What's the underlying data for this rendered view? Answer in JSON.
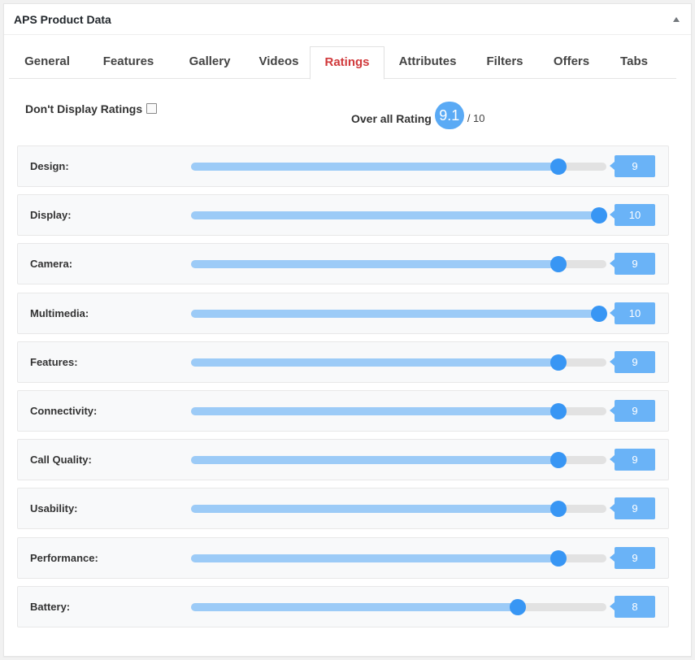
{
  "panel": {
    "title": "APS Product Data",
    "toggle_icon": "triangle-up-icon"
  },
  "tabs": [
    {
      "label": "General"
    },
    {
      "label": "Features"
    },
    {
      "label": "Gallery"
    },
    {
      "label": "Videos"
    },
    {
      "label": "Ratings",
      "active": true
    },
    {
      "label": "Attributes"
    },
    {
      "label": "Filters"
    },
    {
      "label": "Offers"
    },
    {
      "label": "Tabs"
    }
  ],
  "ratings": {
    "dont_display_label": "Don't Display Ratings",
    "dont_display_checked": false,
    "overall_label": "Over all Rating",
    "overall_value": "9.1",
    "overall_max": "/ 10",
    "max": 10,
    "items": [
      {
        "label": "Design:",
        "value": 9
      },
      {
        "label": "Display:",
        "value": 10
      },
      {
        "label": "Camera:",
        "value": 9
      },
      {
        "label": "Multimedia:",
        "value": 10
      },
      {
        "label": "Features:",
        "value": 9
      },
      {
        "label": "Connectivity:",
        "value": 9
      },
      {
        "label": "Call Quality:",
        "value": 9
      },
      {
        "label": "Usability:",
        "value": 9
      },
      {
        "label": "Performance:",
        "value": 9
      },
      {
        "label": "Battery:",
        "value": 8
      }
    ]
  },
  "colors": {
    "accent": "#3896f4",
    "active_tab": "#d0393b",
    "value_box": "#6ab3f7",
    "track_fill": "#9ccbf7"
  }
}
